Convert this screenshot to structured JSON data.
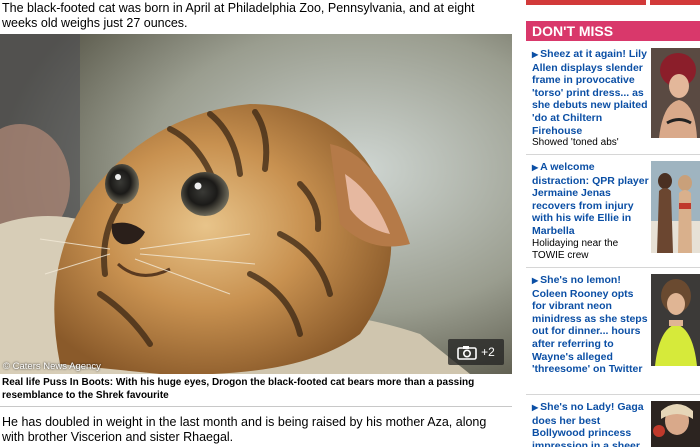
{
  "article": {
    "intro": "The black-footed cat was born in April at Philadelphia Zoo, Pennsylvania, and at eight weeks old weighs just 27 ounces.",
    "photo_credit": "© Caters News Agency",
    "gallery_count": "+2",
    "gallery_icon": "camera-icon",
    "caption": "Real life Puss In Boots: With his huge eyes, Drogon the black-footed cat bears more than a passing resemblance to the Shrek favourite",
    "body": "He has doubled in weight in the last month and is being raised by his mother Aza, along with brother Viscerion and sister Rhaegal."
  },
  "sidebar": {
    "header": "DON'T MISS",
    "colors": {
      "header_bg": "#d9386b",
      "link": "#0b4fa5",
      "stripe": "#d23a3a"
    },
    "items": [
      {
        "headline": "Sheez at it again! Lily Allen displays slender frame in provocative 'torso' print dress... as she debuts new plaited 'do at Chiltern Firehouse",
        "sub": "Showed 'toned abs'"
      },
      {
        "headline": "A welcome distraction: QPR player Jermaine Jenas recovers from injury with his wife Ellie in Marbella",
        "sub": "Holidaying near the TOWIE crew"
      },
      {
        "headline": "She's no lemon! Coleen Rooney opts for vibrant neon minidress as she steps out for dinner... hours after referring to Wayne's alleged 'threesome' on Twitter",
        "sub": ""
      },
      {
        "headline": "She's no Lady! Gaga does her best Bollywood princess impression in a sheer",
        "sub": ""
      }
    ]
  }
}
